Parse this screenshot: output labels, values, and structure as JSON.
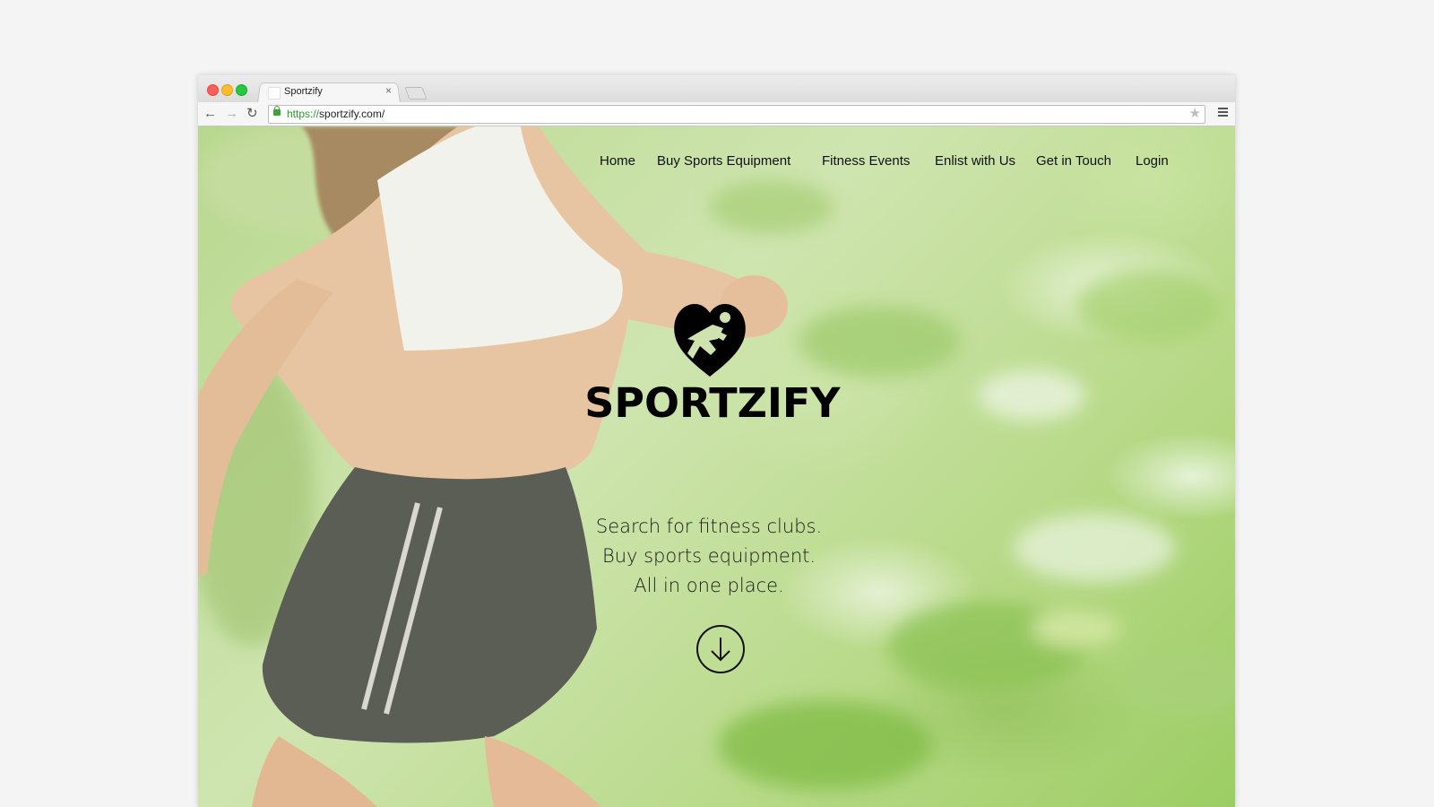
{
  "browser": {
    "tab_title": "Sportzify",
    "tab_close": "×",
    "url_scheme": "https://",
    "url_rest": "sportzify.com/",
    "nav_back": "←",
    "nav_forward": "→",
    "nav_reload": "↻",
    "star": "★"
  },
  "site": {
    "nav": [
      "Home",
      "Buy Sports Equipment",
      "Fitness Events",
      "Enlist with Us",
      "Get in Touch",
      "Login"
    ],
    "brand": "SPORTZIFY",
    "tagline": [
      "Search for fitness clubs.",
      "Buy sports equipment.",
      "All in one place."
    ]
  },
  "icons": {
    "logo": "heart-runner-icon",
    "scroll": "arrow-down-circle-icon",
    "lock": "lock-icon",
    "star": "bookmark-star-icon",
    "menu": "hamburger-menu-icon"
  },
  "colors": {
    "traffic_red": "#fc5f57",
    "traffic_yellow": "#fdbc2e",
    "traffic_green": "#27c840",
    "secure_green": "#2a9a2a",
    "text": "#111111"
  }
}
